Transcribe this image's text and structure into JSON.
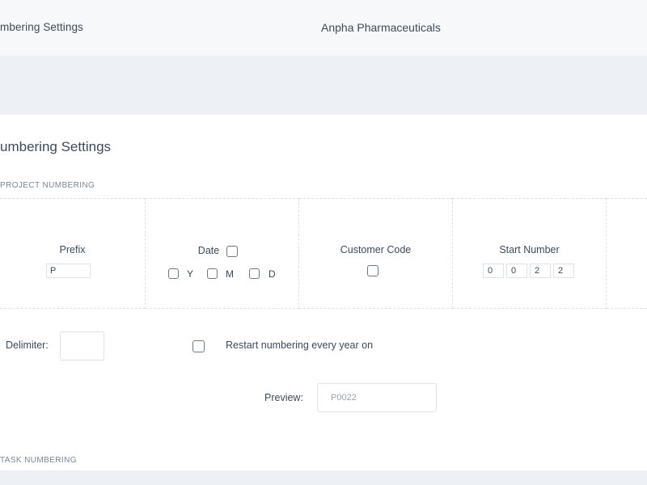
{
  "header": {
    "breadcrumb": "mbering Settings",
    "company": "Anpha Pharmaceuticals"
  },
  "page": {
    "title": "umbering Settings"
  },
  "project_numbering": {
    "section_label": "PROJECT NUMBERING",
    "prefix": {
      "label": "Prefix",
      "value": "P"
    },
    "date": {
      "label": "Date",
      "y_label": "Y",
      "m_label": "M",
      "d_label": "D"
    },
    "customer_code": {
      "label": "Customer Code"
    },
    "start_number": {
      "label": "Start Number",
      "digits": [
        "0",
        "0",
        "2",
        "2"
      ]
    },
    "delimiter": {
      "label": "Delimiter:",
      "value": ""
    },
    "restart": {
      "label": "Restart numbering every year on"
    },
    "preview": {
      "label": "Preview:",
      "value": "P0022"
    }
  },
  "task_numbering": {
    "section_label": "TASK NUMBERING"
  }
}
